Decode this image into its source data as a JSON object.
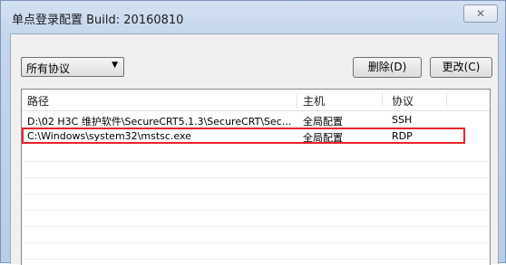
{
  "window": {
    "title": "单点登录配置 Build: 20160810",
    "close_glyph": "✕"
  },
  "toolbar": {
    "protocol_filter": {
      "selected": "所有协议",
      "arrow": "▼"
    },
    "delete_label": "删除(D)",
    "modify_label": "更改(C)"
  },
  "table": {
    "columns": [
      "路径",
      "主机",
      "协议"
    ],
    "rows": [
      {
        "path": "D:\\02 H3C 维护软件\\SecureCRT5.1.3\\SecureCRT\\Sec...",
        "host": "全局配置",
        "protocol": "SSH",
        "highlighted": false
      },
      {
        "path": "C:\\Windows\\system32\\mstsc.exe",
        "host": "全局配置",
        "protocol": "RDP",
        "highlighted": true
      }
    ]
  },
  "colors": {
    "highlight_border": "#e8222c",
    "title_bar": "#c5d6ec"
  }
}
